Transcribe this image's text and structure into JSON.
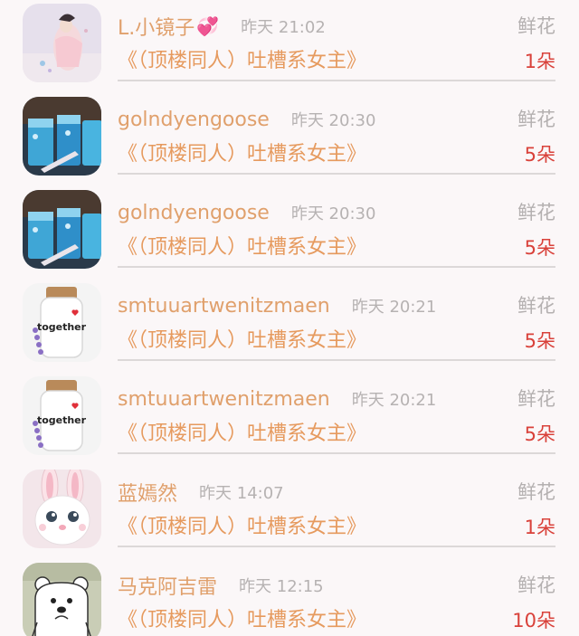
{
  "rows": [
    {
      "name": "L.小镜子",
      "heart_icon": "💞",
      "time": "昨天 21:02",
      "title": "《（顶楼同人）吐槽系女主》",
      "gift_label": "鲜花",
      "count": "1朵",
      "avatar": "girl-photo"
    },
    {
      "name": "golndyengoose",
      "time": "昨天 20:30",
      "title": "《（顶楼同人）吐槽系女主》",
      "gift_label": "鲜花",
      "count": "5朵",
      "avatar": "blue-drinks"
    },
    {
      "name": "golndyengoose",
      "time": "昨天 20:30",
      "title": "《（顶楼同人）吐槽系女主》",
      "gift_label": "鲜花",
      "count": "5朵",
      "avatar": "blue-drinks"
    },
    {
      "name": "smtuuartwenitzmaen",
      "time": "昨天 20:21",
      "title": "《（顶楼同人）吐槽系女主》",
      "gift_label": "鲜花",
      "count": "5朵",
      "avatar": "together-jar"
    },
    {
      "name": "smtuuartwenitzmaen",
      "time": "昨天 20:21",
      "title": "《（顶楼同人）吐槽系女主》",
      "gift_label": "鲜花",
      "count": "5朵",
      "avatar": "together-jar"
    },
    {
      "name": "蓝嫣然",
      "time": "昨天 14:07",
      "title": "《（顶楼同人）吐槽系女主》",
      "gift_label": "鲜花",
      "count": "1朵",
      "avatar": "bunny"
    },
    {
      "name": "马克阿吉雷",
      "time": "昨天 12:15",
      "title": "《（顶楼同人）吐槽系女主》",
      "gift_label": "鲜花",
      "count": "10朵",
      "avatar": "ice-bear"
    }
  ],
  "colors": {
    "name": "#e0a06c",
    "title": "#e69a5e",
    "count": "#d9413a",
    "muted": "#b4b0b0",
    "background": "#fbf7f8"
  }
}
